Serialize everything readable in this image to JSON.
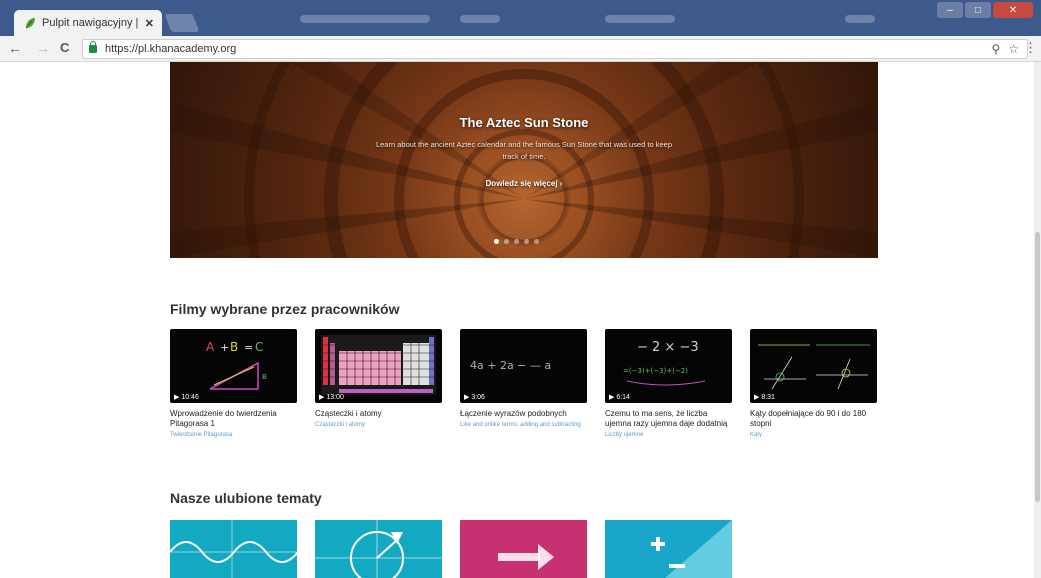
{
  "browser": {
    "tab_title": "Pulpit nawigacyjny | Kha",
    "tab_close": "✕",
    "url": "https://pl.khanacademy.org",
    "back_glyph": "←",
    "forward_glyph": "→",
    "reload_glyph": "C",
    "zoom_glyph": "⚲",
    "star_glyph": "☆",
    "menu_glyph": "⋮",
    "min_glyph": "–",
    "max_glyph": "□",
    "close_glyph": "✕"
  },
  "hero": {
    "title": "The Aztec Sun Stone",
    "description": "Learn about the ancient Aztec calendar and the famous Sun Stone that was used to keep track of time.",
    "link": "Dowiedz się więcej ›",
    "slides": 5,
    "active_slide": 0
  },
  "staff_picks": {
    "title": "Filmy wybrane przez pracowników",
    "videos": [
      {
        "duration": "▶ 10:46",
        "title": "Wprowadzenie do twierdzenia Pitagorasa 1",
        "subtitle": "Twierdzenie Pitagorasa"
      },
      {
        "duration": "▶ 13:00",
        "title": "Cząsteczki i atomy",
        "subtitle": "Cząsteczki i atomy"
      },
      {
        "duration": "▶ 3:06",
        "title": "Łączenie wyrazów podobnych",
        "subtitle": "Like and unlike terms: adding and subtracting"
      },
      {
        "duration": "▶ 6:14",
        "title": "Czemu to ma sens, że liczba ujemna razy ujemna daje dodatnią",
        "subtitle": "Liczby ujemne"
      },
      {
        "duration": "▶ 8:31",
        "title": "Kąty dopełniające do 90 i do 180 stopni",
        "subtitle": "Kąty"
      }
    ]
  },
  "favorite_topics": {
    "title": "Nasze ulubione tematy"
  },
  "colors": {
    "titlebar": "#3d5a8c",
    "link_blue": "#5a9fc6",
    "topic_teal": "#14a9c2",
    "topic_pink": "#c8316f"
  }
}
